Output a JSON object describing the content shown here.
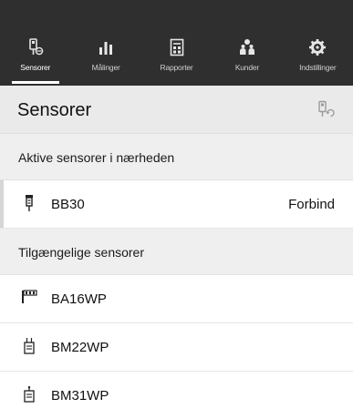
{
  "tabs": [
    {
      "label": "Sensorer",
      "icon": "sensor-pen-icon",
      "active": true
    },
    {
      "label": "Målinger",
      "icon": "bar-chart-icon",
      "active": false
    },
    {
      "label": "Rapporter",
      "icon": "report-icon",
      "active": false
    },
    {
      "label": "Kunder",
      "icon": "customers-icon",
      "active": false
    },
    {
      "label": "Indstillinger",
      "icon": "gear-icon",
      "active": false
    }
  ],
  "page": {
    "title": "Sensorer",
    "action_icon": "sensor-refresh-icon"
  },
  "active_section": {
    "header": "Aktive sensorer i nærheden",
    "items": [
      {
        "name": "BB30",
        "icon": "probe-icon",
        "action": "Forbind"
      }
    ]
  },
  "available_section": {
    "header": "Tilgængelige sensorer",
    "items": [
      {
        "name": "BA16WP",
        "icon": "comb-sensor-icon"
      },
      {
        "name": "BM22WP",
        "icon": "twin-pin-sensor-icon"
      },
      {
        "name": "BM31WP",
        "icon": "single-pin-sensor-icon"
      }
    ]
  },
  "colors": {
    "topbar": "#2f2f2f",
    "background": "#f2f2f2",
    "row": "#ffffff"
  }
}
